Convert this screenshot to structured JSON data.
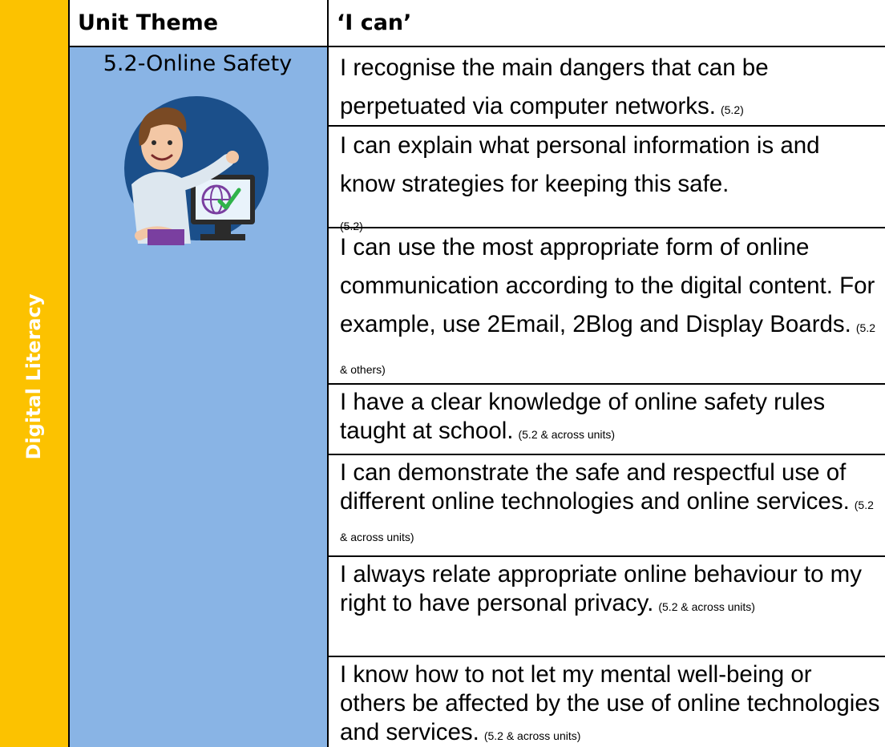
{
  "table": {
    "subject": "Digital Literacy",
    "headers": {
      "theme": "Unit Theme",
      "outcomes": "‘I can’"
    },
    "theme": "5.2-Online Safety",
    "statements": [
      {
        "text": "I recognise the main dangers that can be perpetuated via computer networks.",
        "ref": "(5.2)"
      },
      {
        "text": "I can explain what personal information is and know strategies for keeping this safe.",
        "ref": "(5.2)"
      },
      {
        "text": "I can use the most appropriate form of online communication according to the digital content. For example, use 2Email, 2Blog and Display Boards.",
        "ref": "(5.2 & others)"
      },
      {
        "text": "I have a clear knowledge of online safety rules taught at school.",
        "ref": "(5.2 & across units)"
      },
      {
        "text": "I can demonstrate the safe and respectful use of different online technologies and online services.",
        "ref": "(5.2 & across units)"
      },
      {
        "text": "I always relate appropriate online behaviour to my right to have personal privacy.",
        "ref": "(5.2 & across units)"
      },
      {
        "text": "I know how to not let my mental well-being or others be affected by the use of online technologies and services.",
        "ref": "(5.2 & across units)"
      }
    ]
  },
  "colors": {
    "subject_bg": "#fcc200",
    "theme_bg": "#89b4e5",
    "border": "#000000"
  },
  "icons": [
    "teacher-avatar-icon",
    "globe-check-icon"
  ]
}
